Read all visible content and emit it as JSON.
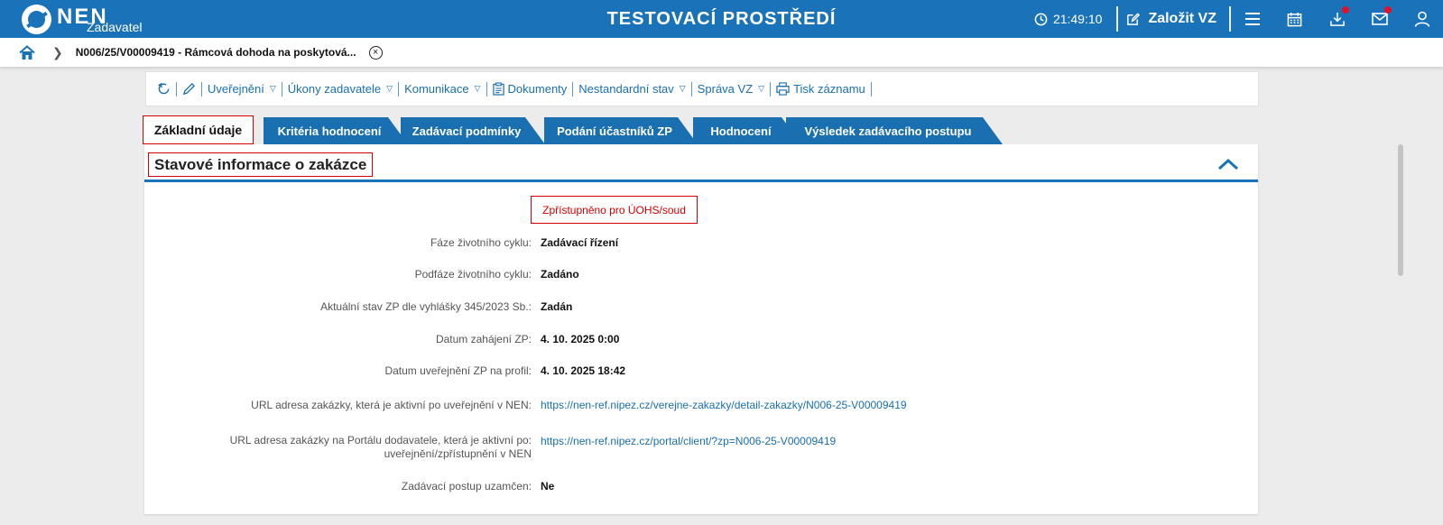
{
  "header": {
    "logo_text": "NEN",
    "logo_sub": "Zadavatel",
    "env_title": "TESTOVACÍ PROSTŘEDÍ",
    "clock": "21:49:10",
    "create_label": "Založit VZ",
    "icons": [
      "menu-icon",
      "calendar-icon",
      "download-icon",
      "mail-icon",
      "user-icon"
    ],
    "accent": "#1a73b8",
    "notification_color": "#e2102a"
  },
  "breadcrumb": {
    "text": "N006/25/V00009419 - Rámcová dohoda na poskytová...",
    "close_glyph": "×"
  },
  "toolbar": {
    "publish": "Uveřejnění",
    "actions": "Úkony zadavatele",
    "communication": "Komunikace",
    "documents": "Dokumenty",
    "nonstandard": "Nestandardní stav",
    "admin": "Správa VZ",
    "print": "Tisk záznamu"
  },
  "tabs": [
    {
      "label": "Základní údaje",
      "active": true
    },
    {
      "label": "Kritéria hodnocení"
    },
    {
      "label": "Zadávací podmínky"
    },
    {
      "label": "Podání účastníků ZP"
    },
    {
      "label": "Hodnocení"
    },
    {
      "label": "Výsledek zadávacího postupu"
    }
  ],
  "section": {
    "title": "Stavové informace o zakázce",
    "badge": "Zpřístupněno pro ÚOHS/soud",
    "fields": [
      {
        "label": "Fáze životního cyklu",
        "value": "Zadávací řízení"
      },
      {
        "label": "Podfáze životního cyklu",
        "value": "Zadáno"
      },
      {
        "label": "Aktuální stav ZP dle vyhlášky 345/2023 Sb.",
        "value": "Zadán"
      },
      {
        "label": "Datum zahájení ZP",
        "value": "4. 10. 2025 0:00"
      },
      {
        "label": "Datum uveřejnění ZP na profil",
        "value": "4. 10. 2025 18:42"
      },
      {
        "label": "URL adresa zakázky, která je aktivní po uveřejnění v NEN",
        "value": "https://nen-ref.nipez.cz/verejne-zakazky/detail-zakazky/N006-25-V00009419"
      },
      {
        "label_line1": "URL adresa zakázky na Portálu dodavatele, která je aktivní po",
        "label_line2": "uveřejnění/zpřístupnění v NEN",
        "value": "https://nen-ref.nipez.cz/portal/client/?zp=N006-25-V00009419"
      },
      {
        "label": "Zadávací postup uzamčen",
        "value": "Ne"
      }
    ]
  }
}
